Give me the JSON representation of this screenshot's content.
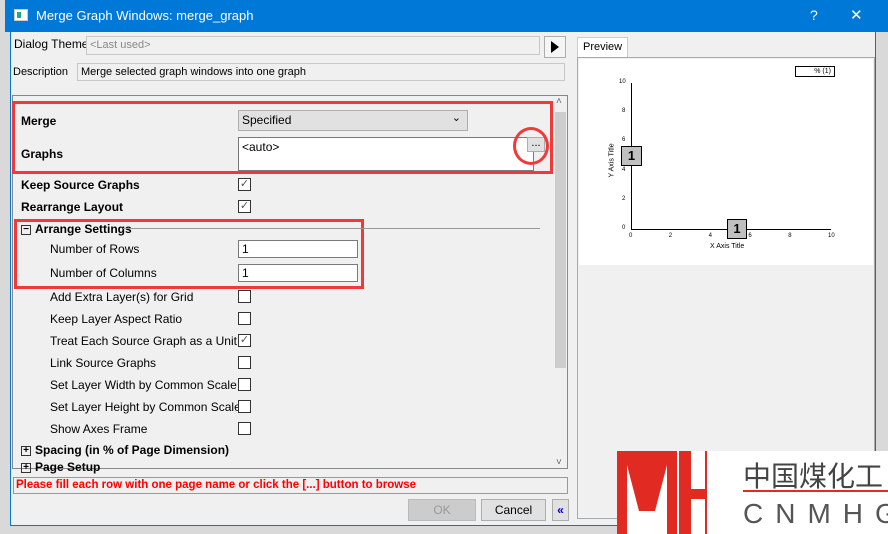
{
  "window": {
    "title": "Merge Graph Windows: merge_graph",
    "help": "?",
    "close": "✕"
  },
  "theme": {
    "label": "Dialog Theme",
    "value": "<Last used>"
  },
  "description": {
    "label": "Description",
    "value": "Merge selected graph windows into one graph"
  },
  "settings": {
    "merge": {
      "label": "Merge",
      "value": "Specified"
    },
    "graphs": {
      "label": "Graphs",
      "value": "<auto>",
      "browse": "..."
    },
    "keep_source": {
      "label": "Keep Source Graphs",
      "checked": true
    },
    "rearrange": {
      "label": "Rearrange Layout",
      "checked": true
    },
    "arrange": {
      "label": "Arrange Settings",
      "rows": {
        "label": "Number of Rows",
        "value": "1"
      },
      "cols": {
        "label": "Number of Columns",
        "value": "1"
      },
      "options": [
        {
          "label": "Add Extra Layer(s) for Grid",
          "checked": false
        },
        {
          "label": "Keep Layer Aspect Ratio",
          "checked": false
        },
        {
          "label": "Treat Each Source Graph as a Unit",
          "checked": true
        },
        {
          "label": "Link Source Graphs",
          "checked": false
        },
        {
          "label": "Set Layer Width by Common Scale",
          "checked": false
        },
        {
          "label": "Set Layer Height by Common Scale",
          "checked": false
        },
        {
          "label": "Show Axes Frame",
          "checked": false
        }
      ]
    },
    "spacing": {
      "label": "Spacing (in % of Page Dimension)"
    },
    "page_setup": {
      "label": "Page Setup"
    }
  },
  "message": "Please fill each row with one page name or click the [...] button to browse",
  "buttons": {
    "ok": "OK",
    "cancel": "Cancel",
    "collapse": "«"
  },
  "preview": {
    "tab": "Preview",
    "legend": "% (1)",
    "x_title": "X Axis Title",
    "y_title": "Y Axis Title",
    "x_ticks": [
      "0",
      "2",
      "4",
      "6",
      "8",
      "10"
    ],
    "y_ticks": [
      "0",
      "2",
      "4",
      "6",
      "8",
      "10"
    ],
    "box_label": "1"
  },
  "watermark": {
    "cn": "中国煤化工",
    "en": "CNMHG"
  }
}
